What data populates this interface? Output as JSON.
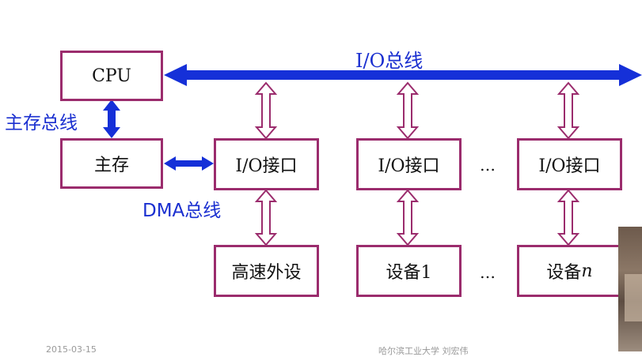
{
  "diagram": {
    "io_bus_label": "I/O总线",
    "main_bus_label": "主存总线",
    "dma_bus_label": "DMA总线",
    "cpu": "CPU",
    "main_memory": "主存",
    "interfaces": [
      "I/O接口",
      "I/O接口",
      "I/O接口"
    ],
    "devices": {
      "d1": "高速外设",
      "d2": "设备1",
      "d3_text": "设备",
      "d3_var": "n"
    },
    "ellipsis": "…"
  },
  "footer": {
    "date": "2015-03-15",
    "author": "哈尔滨工业大学  刘宏伟"
  },
  "colors": {
    "bus": "#1530d8",
    "box_border": "#9b2c6d",
    "label": "#1a2fd0"
  }
}
